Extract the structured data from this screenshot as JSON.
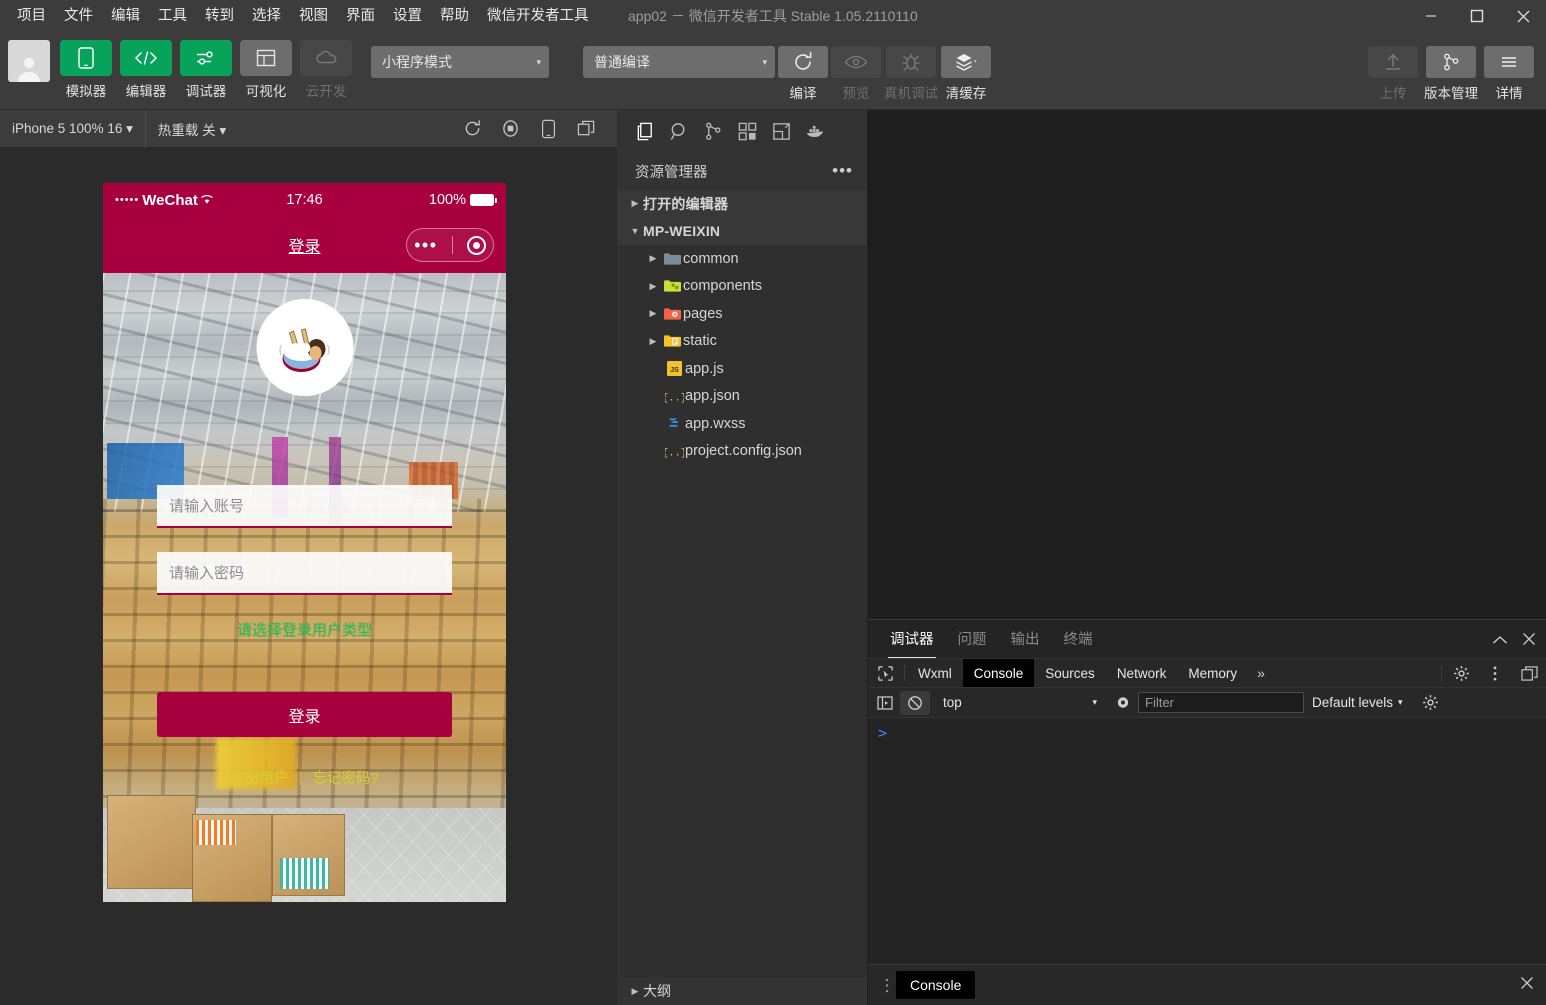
{
  "window": {
    "title": "app02 － 微信开发者工具 Stable 1.05.2110110",
    "minimize_icon": "minimize-icon",
    "maximize_icon": "maximize-icon",
    "close_icon": "close-icon"
  },
  "menubar": {
    "items": [
      {
        "label": "项目"
      },
      {
        "label": "文件"
      },
      {
        "label": "编辑"
      },
      {
        "label": "工具"
      },
      {
        "label": "转到"
      },
      {
        "label": "选择"
      },
      {
        "label": "视图"
      },
      {
        "label": "界面"
      },
      {
        "label": "设置"
      },
      {
        "label": "帮助"
      },
      {
        "label": "微信开发者工具"
      }
    ]
  },
  "toolbar": {
    "avatar_icon": "user-avatar-icon",
    "left_items": [
      {
        "label": "模拟器",
        "icon": "phone-icon",
        "style": "green",
        "disabled": false
      },
      {
        "label": "编辑器",
        "icon": "code-icon",
        "style": "green",
        "disabled": false
      },
      {
        "label": "调试器",
        "icon": "sliders-icon",
        "style": "green",
        "disabled": false
      },
      {
        "label": "可视化",
        "icon": "layout-icon",
        "style": "grey",
        "disabled": false
      },
      {
        "label": "云开发",
        "icon": "cloud-icon",
        "style": "dim",
        "disabled": true
      }
    ],
    "mode_select": {
      "value": "小程序模式",
      "caret": "▾"
    },
    "compile_select": {
      "value": "普通编译",
      "caret": "▾"
    },
    "compile_group": [
      {
        "label": "编译",
        "icon": "refresh-icon",
        "disabled": false
      },
      {
        "label": "预览",
        "icon": "eye-icon",
        "disabled": true
      },
      {
        "label": "真机调试",
        "icon": "bug-icon",
        "disabled": true
      },
      {
        "label": "清缓存",
        "icon": "layers-icon",
        "disabled": false,
        "caret": "▾"
      }
    ],
    "right_items": [
      {
        "label": "上传",
        "icon": "upload-icon",
        "disabled": true
      },
      {
        "label": "版本管理",
        "icon": "git-branch-icon",
        "disabled": false
      },
      {
        "label": "详情",
        "icon": "hamburger-icon",
        "disabled": false
      }
    ]
  },
  "simulator": {
    "device_select": "iPhone 5 100% 16 ▾",
    "hot_reload": "热重载 关 ▾",
    "bar_icons": [
      "refresh-icon",
      "record-icon",
      "rotate-device-icon",
      "detach-window-icon"
    ],
    "phone": {
      "status": {
        "carrier_dots": "•••••",
        "carrier": "WeChat",
        "wifi_icon": "wifi-icon",
        "time": "17:46",
        "battery_pct": "100%",
        "battery_icon": "battery-full-icon"
      },
      "nav": {
        "title": "登录",
        "capsule_dots": "•••",
        "capsule_target_icon": "target-icon"
      },
      "avatar_icon": "cartoon-avatar-icon",
      "account_placeholder": "请输入账号",
      "password_placeholder": "请输入密码",
      "hint_text": "请选择登录用户类型",
      "login_button": "登录",
      "links": [
        {
          "label": "注册用户"
        },
        {
          "label": "忘记密码?"
        }
      ],
      "link_separator": "|"
    }
  },
  "explorer": {
    "activity_icons": [
      "files-icon",
      "search-icon",
      "source-control-icon",
      "extensions-icon",
      "wxml-panel-icon",
      "docker-icon"
    ],
    "title": "资源管理器",
    "more_icon": "ellipsis-icon",
    "sections": [
      {
        "label": "打开的编辑器",
        "expanded": false,
        "twisty": "▶"
      },
      {
        "label": "MP-WEIXIN",
        "expanded": true,
        "twisty": "▼"
      }
    ],
    "tree": [
      {
        "label": "common",
        "type": "folder",
        "icon": "folder-grey-icon",
        "twisty": "▶"
      },
      {
        "label": "components",
        "type": "folder",
        "icon": "folder-components-icon",
        "twisty": "▶"
      },
      {
        "label": "pages",
        "type": "folder",
        "icon": "folder-pages-icon",
        "twisty": "▶"
      },
      {
        "label": "static",
        "type": "folder",
        "icon": "folder-static-icon",
        "twisty": "▶"
      },
      {
        "label": "app.js",
        "type": "file",
        "icon": "js-file-icon"
      },
      {
        "label": "app.json",
        "type": "file",
        "icon": "json-file-icon"
      },
      {
        "label": "app.wxss",
        "type": "file",
        "icon": "wxss-file-icon"
      },
      {
        "label": "project.config.json",
        "type": "file",
        "icon": "json-file-icon"
      }
    ],
    "outline": {
      "label": "大纲",
      "twisty": "▶"
    }
  },
  "devpanel": {
    "panel_tabs": [
      {
        "label": "调试器",
        "active": true
      },
      {
        "label": "问题",
        "active": false
      },
      {
        "label": "输出",
        "active": false
      },
      {
        "label": "终端",
        "active": false
      }
    ],
    "collapse_icon": "chevron-up-icon",
    "close_icon": "close-icon",
    "devtools_tabs": [
      {
        "label": "Wxml",
        "active": false
      },
      {
        "label": "Console",
        "active": true
      },
      {
        "label": "Sources",
        "active": false
      },
      {
        "label": "Network",
        "active": false
      },
      {
        "label": "Memory",
        "active": false
      }
    ],
    "inspect_icon": "inspect-cursor-icon",
    "overflow_label": "»",
    "settings_icon": "gear-icon",
    "kebab_icon": "kebab-menu-icon",
    "dock_icon": "dock-side-icon",
    "console_toolbar": {
      "sidebar_icon": "console-sidebar-icon",
      "clear_icon": "clear-console-icon",
      "context": "top",
      "context_caret": "▾",
      "eye_icon": "live-expression-icon",
      "filter_placeholder": "Filter",
      "filter_value": "",
      "levels": "Default levels",
      "levels_caret": "▾",
      "gear_icon": "gear-icon"
    },
    "prompt": ">"
  },
  "drawer": {
    "grip_icon": "drawer-grip-icon",
    "tab_label": "Console",
    "close_icon": "close-icon"
  },
  "colors": {
    "chrome_bg": "#3c3c3c",
    "accent_green": "#07a35a",
    "brand_crimson": "#a8003e",
    "editor_bg": "#1e1e1e",
    "sidebar_bg": "#2f2f2f",
    "link_yellow": "#d6d12c",
    "hint_green": "#1ec95b",
    "prompt_blue": "#3b8ee0"
  }
}
